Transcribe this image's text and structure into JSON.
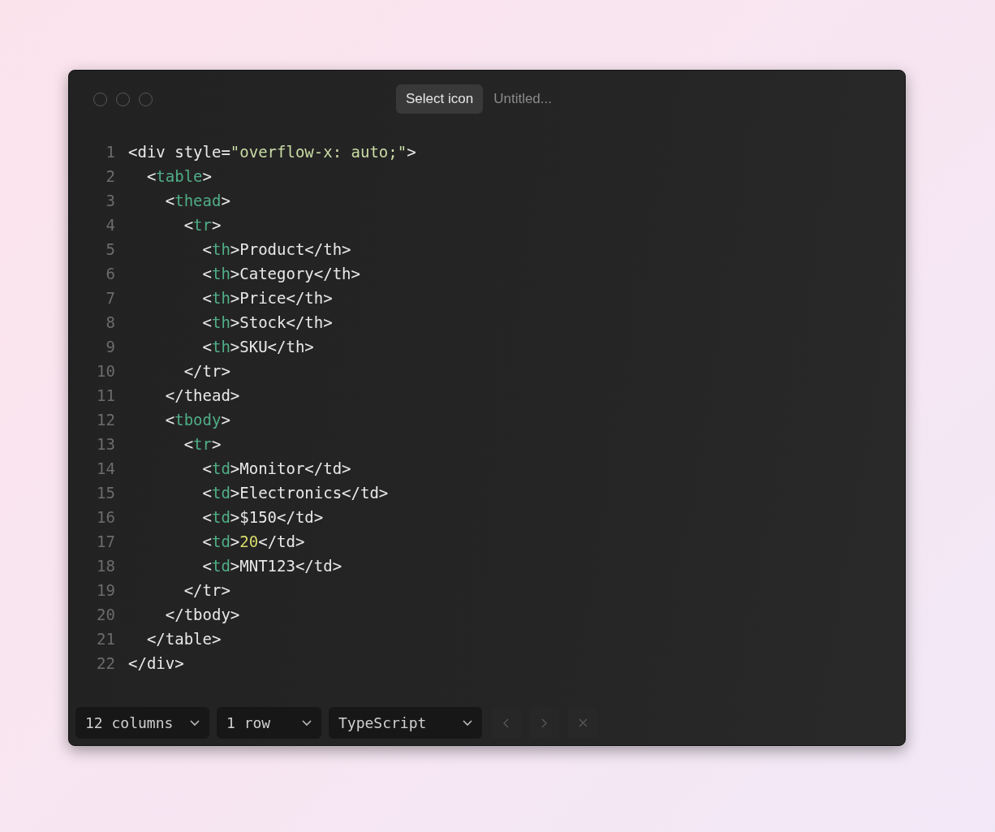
{
  "title_bar": {
    "button": "Select icon",
    "title": "Untitled..."
  },
  "editor": {
    "lines": [
      {
        "number": "1",
        "tokens": [
          {
            "kind": "plain",
            "text": "<div style="
          },
          {
            "kind": "string",
            "text": "\"overflow-x: auto;\""
          },
          {
            "kind": "plain",
            "text": ">"
          }
        ]
      },
      {
        "number": "2",
        "tokens": [
          {
            "kind": "plain",
            "text": "  <"
          },
          {
            "kind": "tag",
            "text": "table"
          },
          {
            "kind": "plain",
            "text": ">"
          }
        ]
      },
      {
        "number": "3",
        "tokens": [
          {
            "kind": "plain",
            "text": "    <"
          },
          {
            "kind": "tag",
            "text": "thead"
          },
          {
            "kind": "plain",
            "text": ">"
          }
        ]
      },
      {
        "number": "4",
        "tokens": [
          {
            "kind": "plain",
            "text": "      <"
          },
          {
            "kind": "tag",
            "text": "tr"
          },
          {
            "kind": "plain",
            "text": ">"
          }
        ]
      },
      {
        "number": "5",
        "tokens": [
          {
            "kind": "plain",
            "text": "        <"
          },
          {
            "kind": "tag",
            "text": "th"
          },
          {
            "kind": "plain",
            "text": ">Product</th>"
          }
        ]
      },
      {
        "number": "6",
        "tokens": [
          {
            "kind": "plain",
            "text": "        <"
          },
          {
            "kind": "tag",
            "text": "th"
          },
          {
            "kind": "plain",
            "text": ">Category</th>"
          }
        ]
      },
      {
        "number": "7",
        "tokens": [
          {
            "kind": "plain",
            "text": "        <"
          },
          {
            "kind": "tag",
            "text": "th"
          },
          {
            "kind": "plain",
            "text": ">Price</th>"
          }
        ]
      },
      {
        "number": "8",
        "tokens": [
          {
            "kind": "plain",
            "text": "        <"
          },
          {
            "kind": "tag",
            "text": "th"
          },
          {
            "kind": "plain",
            "text": ">Stock</th>"
          }
        ]
      },
      {
        "number": "9",
        "tokens": [
          {
            "kind": "plain",
            "text": "        <"
          },
          {
            "kind": "tag",
            "text": "th"
          },
          {
            "kind": "plain",
            "text": ">SKU</th>"
          }
        ]
      },
      {
        "number": "10",
        "tokens": [
          {
            "kind": "plain",
            "text": "      </tr>"
          }
        ]
      },
      {
        "number": "11",
        "tokens": [
          {
            "kind": "plain",
            "text": "    </thead>"
          }
        ]
      },
      {
        "number": "12",
        "tokens": [
          {
            "kind": "plain",
            "text": "    <"
          },
          {
            "kind": "tag",
            "text": "tbody"
          },
          {
            "kind": "plain",
            "text": ">"
          }
        ]
      },
      {
        "number": "13",
        "tokens": [
          {
            "kind": "plain",
            "text": "      <"
          },
          {
            "kind": "tag",
            "text": "tr"
          },
          {
            "kind": "plain",
            "text": ">"
          }
        ]
      },
      {
        "number": "14",
        "tokens": [
          {
            "kind": "plain",
            "text": "        <"
          },
          {
            "kind": "tag",
            "text": "td"
          },
          {
            "kind": "plain",
            "text": ">Monitor</td>"
          }
        ]
      },
      {
        "number": "15",
        "tokens": [
          {
            "kind": "plain",
            "text": "        <"
          },
          {
            "kind": "tag",
            "text": "td"
          },
          {
            "kind": "plain",
            "text": ">Electronics</td>"
          }
        ]
      },
      {
        "number": "16",
        "tokens": [
          {
            "kind": "plain",
            "text": "        <"
          },
          {
            "kind": "tag",
            "text": "td"
          },
          {
            "kind": "plain",
            "text": ">$150</td>"
          }
        ]
      },
      {
        "number": "17",
        "tokens": [
          {
            "kind": "plain",
            "text": "        <"
          },
          {
            "kind": "tag",
            "text": "td"
          },
          {
            "kind": "plain",
            "text": ">"
          },
          {
            "kind": "number",
            "text": "20"
          },
          {
            "kind": "plain",
            "text": "</td>"
          }
        ]
      },
      {
        "number": "18",
        "tokens": [
          {
            "kind": "plain",
            "text": "        <"
          },
          {
            "kind": "tag",
            "text": "td"
          },
          {
            "kind": "plain",
            "text": ">MNT123</td>"
          }
        ]
      },
      {
        "number": "19",
        "tokens": [
          {
            "kind": "plain",
            "text": "      </tr>"
          }
        ]
      },
      {
        "number": "20",
        "tokens": [
          {
            "kind": "plain",
            "text": "    </tbody>"
          }
        ]
      },
      {
        "number": "21",
        "tokens": [
          {
            "kind": "plain",
            "text": "  </table>"
          }
        ]
      },
      {
        "number": "22",
        "tokens": [
          {
            "kind": "plain",
            "text": "</div>"
          }
        ]
      }
    ]
  },
  "footer": {
    "dropdowns": [
      {
        "label": "12 columns"
      },
      {
        "label": "1 row"
      },
      {
        "label": "TypeScript"
      }
    ],
    "buttons": [
      {
        "kind": "previous",
        "disabled": true
      },
      {
        "kind": "next",
        "disabled": true
      },
      {
        "kind": "close",
        "disabled": true
      }
    ]
  }
}
